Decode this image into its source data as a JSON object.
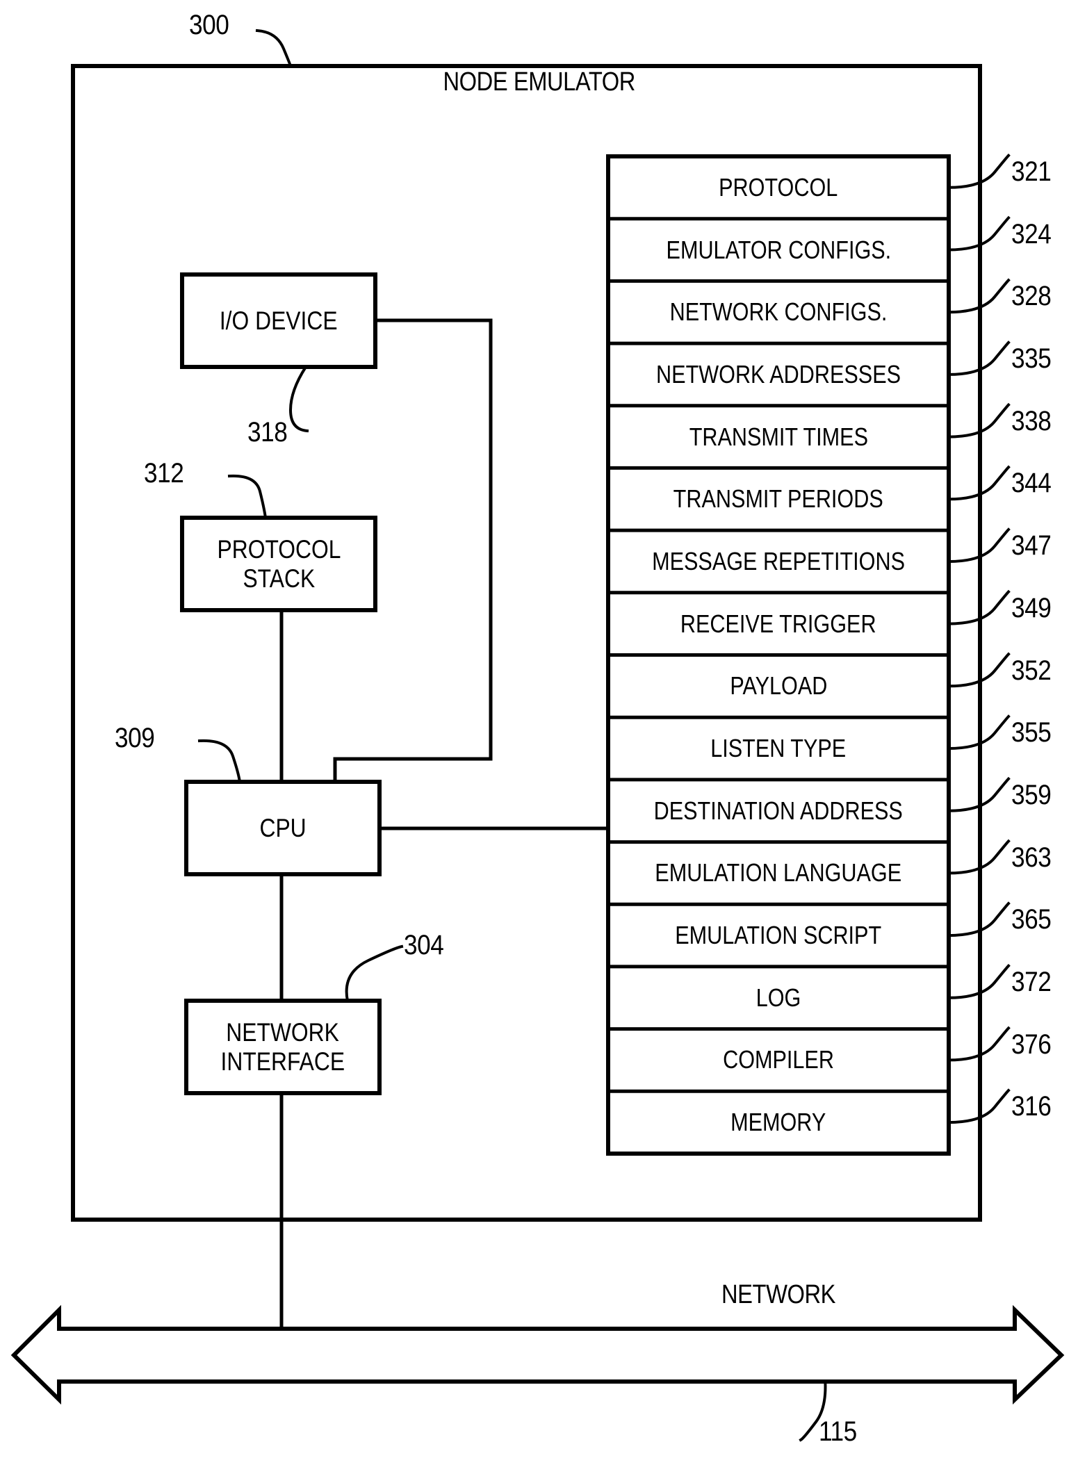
{
  "figure": {
    "outer_ref": "300",
    "outer_title": "NODE EMULATOR",
    "network_label": "NETWORK",
    "network_ref": "115"
  },
  "blocks": [
    {
      "label_lines": [
        "I/O DEVICE"
      ],
      "ref": "318"
    },
    {
      "label_lines": [
        "PROTOCOL",
        "STACK"
      ],
      "ref": "312"
    },
    {
      "label_lines": [
        "CPU"
      ],
      "ref": "309"
    },
    {
      "label_lines": [
        "NETWORK",
        "INTERFACE"
      ],
      "ref": "304"
    }
  ],
  "memory": {
    "rows": [
      {
        "label": "PROTOCOL",
        "ref": "321"
      },
      {
        "label": "EMULATOR CONFIGS.",
        "ref": "324"
      },
      {
        "label": "NETWORK CONFIGS.",
        "ref": "328"
      },
      {
        "label": "NETWORK ADDRESSES",
        "ref": "335"
      },
      {
        "label": "TRANSMIT TIMES",
        "ref": "338"
      },
      {
        "label": "TRANSMIT PERIODS",
        "ref": "344"
      },
      {
        "label": "MESSAGE REPETITIONS",
        "ref": "347"
      },
      {
        "label": "RECEIVE TRIGGER",
        "ref": "349"
      },
      {
        "label": "PAYLOAD",
        "ref": "352"
      },
      {
        "label": "LISTEN TYPE",
        "ref": "355"
      },
      {
        "label": "DESTINATION ADDRESS",
        "ref": "359"
      },
      {
        "label": "EMULATION LANGUAGE",
        "ref": "363"
      },
      {
        "label": "EMULATION SCRIPT",
        "ref": "365"
      },
      {
        "label": "LOG",
        "ref": "372"
      },
      {
        "label": "COMPILER",
        "ref": "376"
      },
      {
        "label": "MEMORY",
        "ref": "316"
      }
    ]
  },
  "colors": {
    "ink": "#000000",
    "paper": "#ffffff"
  }
}
